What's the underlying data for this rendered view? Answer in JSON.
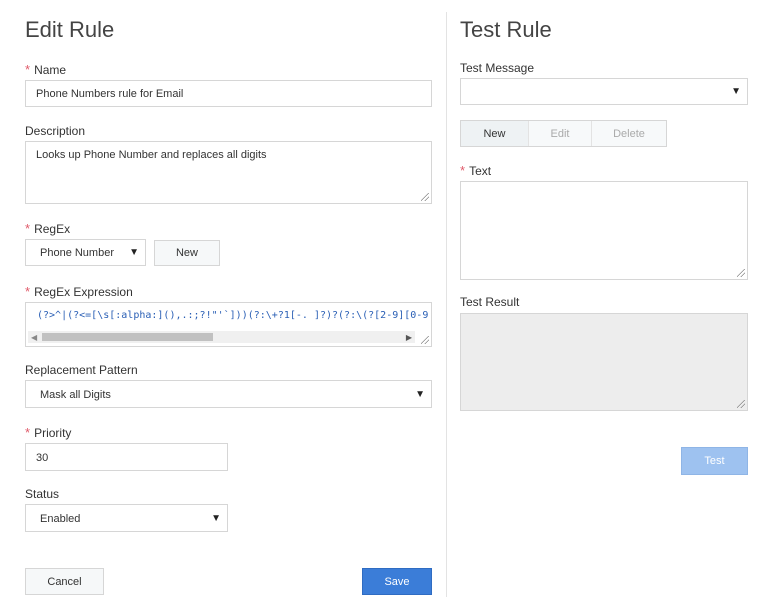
{
  "edit_rule": {
    "title": "Edit Rule",
    "name": {
      "label": "Name",
      "value": "Phone Numbers rule for Email"
    },
    "description": {
      "label": "Description",
      "value": "Looks up Phone Number and replaces all digits"
    },
    "regex": {
      "label": "RegEx",
      "selected": "Phone Number",
      "new_label": "New"
    },
    "regex_expression": {
      "label": "RegEx Expression",
      "value": "(?>^|(?<=[\\s[:alpha:](),.:;?!\"'`]))(?:\\+?1[-. ]?)?(?:\\(?[2-9][0-9]"
    },
    "replacement_pattern": {
      "label": "Replacement Pattern",
      "selected": "Mask all Digits"
    },
    "priority": {
      "label": "Priority",
      "value": "30"
    },
    "status": {
      "label": "Status",
      "selected": "Enabled"
    },
    "cancel_label": "Cancel",
    "save_label": "Save"
  },
  "test_rule": {
    "title": "Test Rule",
    "test_message": {
      "label": "Test Message",
      "selected": ""
    },
    "buttons": {
      "new": "New",
      "edit": "Edit",
      "delete": "Delete"
    },
    "text": {
      "label": "Text",
      "value": ""
    },
    "test_result": {
      "label": "Test Result",
      "value": ""
    },
    "test_label": "Test"
  },
  "colors": {
    "required": "#e05a6a",
    "primary": "#3b7dd8",
    "disabled_primary": "#9ec2f0"
  }
}
